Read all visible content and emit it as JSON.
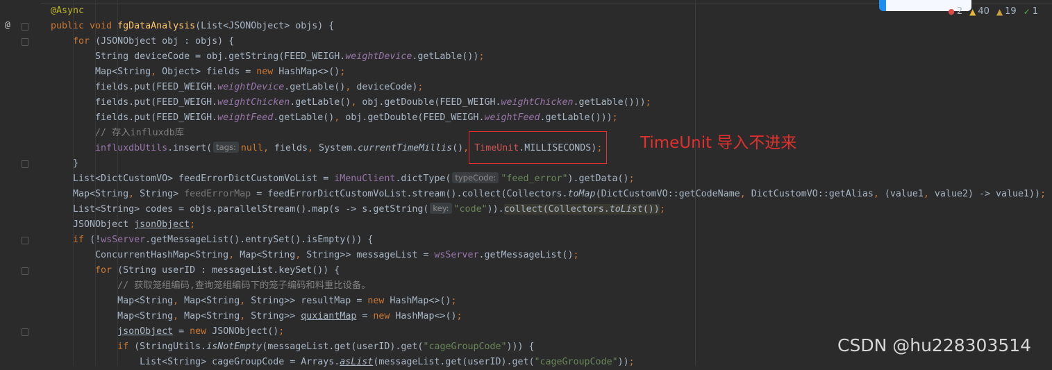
{
  "code_lines": [
    {
      "tokens": [
        {
          "t": "@Async",
          "c": "ann"
        }
      ]
    },
    {
      "tokens": [
        {
          "t": "public void ",
          "c": "kw"
        },
        {
          "t": "fgDataAnalysis",
          "c": "fn"
        },
        {
          "t": "(List<JSONObject> objs) {"
        }
      ]
    },
    {
      "tokens": [
        {
          "t": "    "
        },
        {
          "t": "for ",
          "c": "kw"
        },
        {
          "t": "(JSONObject obj : objs) {"
        }
      ]
    },
    {
      "tokens": [
        {
          "t": "        String deviceCode = obj.getString(FEED_WEIGH."
        },
        {
          "t": "weightDevice",
          "c": "fld"
        },
        {
          "t": ".getLable())"
        },
        {
          "t": ";",
          "c": "kw"
        }
      ]
    },
    {
      "tokens": [
        {
          "t": "        Map<String"
        },
        {
          "t": ", ",
          "c": "kw"
        },
        {
          "t": "Object> fields = "
        },
        {
          "t": "new ",
          "c": "kw"
        },
        {
          "t": "HashMap<>()"
        },
        {
          "t": ";",
          "c": "kw"
        }
      ]
    },
    {
      "tokens": [
        {
          "t": "        fields.put(FEED_WEIGH."
        },
        {
          "t": "weightDevice",
          "c": "fld"
        },
        {
          "t": ".getLable()"
        },
        {
          "t": ", ",
          "c": "kw"
        },
        {
          "t": "deviceCode)"
        },
        {
          "t": ";",
          "c": "kw"
        }
      ]
    },
    {
      "tokens": [
        {
          "t": "        fields.put(FEED_WEIGH."
        },
        {
          "t": "weightChicken",
          "c": "fld"
        },
        {
          "t": ".getLable()"
        },
        {
          "t": ", ",
          "c": "kw"
        },
        {
          "t": "obj.getDouble(FEED_WEIGH."
        },
        {
          "t": "weightChicken",
          "c": "fld"
        },
        {
          "t": ".getLable()))"
        },
        {
          "t": ";",
          "c": "kw"
        }
      ]
    },
    {
      "tokens": [
        {
          "t": "        fields.put(FEED_WEIGH."
        },
        {
          "t": "weightFeed",
          "c": "fld"
        },
        {
          "t": ".getLable()"
        },
        {
          "t": ", ",
          "c": "kw"
        },
        {
          "t": "obj.getDouble(FEED_WEIGH."
        },
        {
          "t": "weightFeed",
          "c": "fld"
        },
        {
          "t": ".getLable()))"
        },
        {
          "t": ";",
          "c": "kw"
        }
      ]
    },
    {
      "tokens": [
        {
          "t": "        // 存入influxdb库",
          "c": "cmt"
        }
      ]
    },
    {
      "tokens": [
        {
          "t": "        "
        },
        {
          "t": "influxdbUtils",
          "c": "fld2"
        },
        {
          "t": ".insert("
        },
        {
          "t": "tags:",
          "c": "hint"
        },
        {
          "t": "null",
          "c": "kw"
        },
        {
          "t": ", ",
          "c": "kw"
        },
        {
          "t": "fields"
        },
        {
          "t": ", ",
          "c": "kw"
        },
        {
          "t": "System."
        },
        {
          "t": "currentTimeMillis",
          "c": "st"
        },
        {
          "t": "()"
        },
        {
          "t": ", ",
          "c": "kw"
        },
        {
          "t": "TimeUnit",
          "c": "err"
        },
        {
          "t": ".MILLISECONDS)"
        },
        {
          "t": ";",
          "c": "kw"
        }
      ]
    },
    {
      "tokens": [
        {
          "t": "    }"
        }
      ]
    },
    {
      "tokens": [
        {
          "t": "    List<DictCustomVO> feedErrorDictCustomVoList = "
        },
        {
          "t": "iMenuClient",
          "c": "fld2"
        },
        {
          "t": ".dictType("
        },
        {
          "t": "typeCode:",
          "c": "hint"
        },
        {
          "t": "\"feed_error\"",
          "c": "str"
        },
        {
          "t": ").getData()"
        },
        {
          "t": ";",
          "c": "kw"
        }
      ]
    },
    {
      "tokens": [
        {
          "t": "    Map<String"
        },
        {
          "t": ", ",
          "c": "kw"
        },
        {
          "t": "String> "
        },
        {
          "t": "feedErrorMap",
          "c": "unused"
        },
        {
          "t": " = feedErrorDictCustomVoList.stream().collect(Collectors."
        },
        {
          "t": "toMap",
          "c": "st"
        },
        {
          "t": "(DictCustomVO::getCodeName"
        },
        {
          "t": ", ",
          "c": "kw"
        },
        {
          "t": "DictCustomVO::getAlias"
        },
        {
          "t": ", ",
          "c": "kw"
        },
        {
          "t": "(value1"
        },
        {
          "t": ", ",
          "c": "kw"
        },
        {
          "t": "value2) -> value1))"
        },
        {
          "t": ";",
          "c": "kw"
        }
      ]
    },
    {
      "tokens": [
        {
          "t": "    List<String> codes = objs.parallelStream().map(s -> s.getString("
        },
        {
          "t": "key:",
          "c": "hint"
        },
        {
          "t": "\"code\"",
          "c": "str"
        },
        {
          "t": "))."
        },
        {
          "t": "collect(Collectors.",
          "c": "hl"
        },
        {
          "t": "toList",
          "c": "hl st"
        },
        {
          "t": "())",
          "c": "hl"
        },
        {
          "t": ";",
          "c": "kw"
        }
      ]
    },
    {
      "tokens": [
        {
          "t": "    JSONObject "
        },
        {
          "t": "jsonObject",
          "c": "ul"
        },
        {
          "t": ";",
          "c": "kw"
        }
      ]
    },
    {
      "tokens": [
        {
          "t": "    "
        },
        {
          "t": "if ",
          "c": "kw"
        },
        {
          "t": "(!"
        },
        {
          "t": "wsServer",
          "c": "fld2"
        },
        {
          "t": ".getMessageList().entrySet().isEmpty()) {"
        }
      ]
    },
    {
      "tokens": [
        {
          "t": "        ConcurrentHashMap<String"
        },
        {
          "t": ", ",
          "c": "kw"
        },
        {
          "t": "Map<String"
        },
        {
          "t": ", ",
          "c": "kw"
        },
        {
          "t": "String>> messageList = "
        },
        {
          "t": "wsServer",
          "c": "fld2"
        },
        {
          "t": ".getMessageList()"
        },
        {
          "t": ";",
          "c": "kw"
        }
      ]
    },
    {
      "tokens": [
        {
          "t": "        "
        },
        {
          "t": "for ",
          "c": "kw"
        },
        {
          "t": "(String userID : messageList.keySet()) {"
        }
      ]
    },
    {
      "tokens": [
        {
          "t": "            // 获取笼组编码,查询笼组编码下的笼子编码和料重比设备。",
          "c": "cmt"
        }
      ]
    },
    {
      "tokens": [
        {
          "t": "            Map<String"
        },
        {
          "t": ", ",
          "c": "kw"
        },
        {
          "t": "Map<String"
        },
        {
          "t": ", ",
          "c": "kw"
        },
        {
          "t": "String>> resultMap = "
        },
        {
          "t": "new ",
          "c": "kw"
        },
        {
          "t": "HashMap<>()"
        },
        {
          "t": ";",
          "c": "kw"
        }
      ]
    },
    {
      "tokens": [
        {
          "t": "            Map<String"
        },
        {
          "t": ", ",
          "c": "kw"
        },
        {
          "t": "Map<String"
        },
        {
          "t": ", ",
          "c": "kw"
        },
        {
          "t": "String>> "
        },
        {
          "t": "quxiantMap",
          "c": "ul"
        },
        {
          "t": " = "
        },
        {
          "t": "new ",
          "c": "kw"
        },
        {
          "t": "HashMap<>()"
        },
        {
          "t": ";",
          "c": "kw"
        }
      ]
    },
    {
      "tokens": [
        {
          "t": "            "
        },
        {
          "t": "jsonObject",
          "c": "ul"
        },
        {
          "t": " = "
        },
        {
          "t": "new ",
          "c": "kw"
        },
        {
          "t": "JSONObject()"
        },
        {
          "t": ";",
          "c": "kw"
        }
      ]
    },
    {
      "tokens": [
        {
          "t": "            "
        },
        {
          "t": "if ",
          "c": "kw"
        },
        {
          "t": "(StringUtils."
        },
        {
          "t": "isNotEmpty",
          "c": "st"
        },
        {
          "t": "(messageList.get(userID).get("
        },
        {
          "t": "\"cageGroupCode\"",
          "c": "str"
        },
        {
          "t": "))) {"
        }
      ]
    },
    {
      "tokens": [
        {
          "t": "                List<String> cageGroupCode = Arrays."
        },
        {
          "t": "asList",
          "c": "st ul"
        },
        {
          "t": "(messageList.get(userID).get("
        },
        {
          "t": "\"cageGroupCode\"",
          "c": "str"
        },
        {
          "t": "))"
        },
        {
          "t": ";",
          "c": "kw"
        }
      ]
    }
  ],
  "annotation": {
    "text": "TimeUnit 导入不进来",
    "color": "#e2302e"
  },
  "status": {
    "errors": "2",
    "warnings": "40",
    "weak_warnings": "19",
    "ok": "1"
  },
  "gutter": {
    "override_marker": "@"
  },
  "watermark": "CSDN @hu228303514",
  "colors": {
    "keyword": "#cc7832",
    "string": "#6a8759",
    "field": "#9876aa",
    "method": "#ffc66d",
    "comment": "#808080",
    "annotation": "#bbb529",
    "error": "#d25252"
  }
}
